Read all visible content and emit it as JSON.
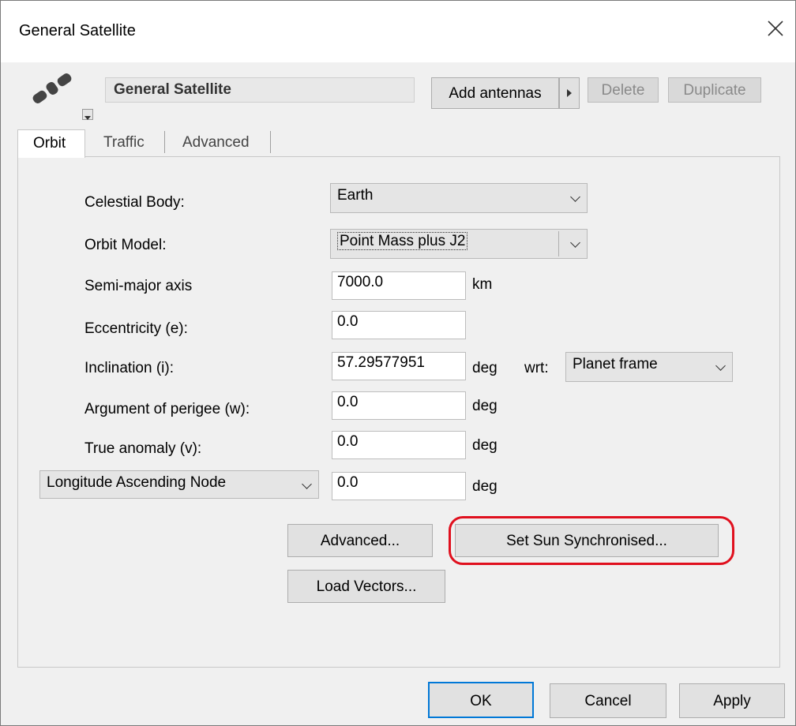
{
  "window": {
    "title": "General Satellite"
  },
  "header": {
    "name_value": "General Satellite",
    "add_antennas_label": "Add antennas",
    "delete_label": "Delete",
    "duplicate_label": "Duplicate"
  },
  "tabs": [
    {
      "label": "Orbit",
      "active": true
    },
    {
      "label": "Traffic",
      "active": false
    },
    {
      "label": "Advanced",
      "active": false
    }
  ],
  "orbit": {
    "celestial_body_label": "Celestial Body:",
    "celestial_body_value": "Earth",
    "orbit_model_label": "Orbit Model:",
    "orbit_model_value": "Point Mass plus J2",
    "semi_major_axis_label": "Semi-major axis",
    "semi_major_axis_value": "7000.0",
    "semi_major_axis_unit": "km",
    "eccentricity_label": "Eccentricity (e):",
    "eccentricity_value": "0.0",
    "inclination_label": "Inclination (i):",
    "inclination_value": "57.29577951",
    "inclination_unit": "deg",
    "wrt_label": "wrt:",
    "wrt_value": "Planet frame",
    "arg_perigee_label": "Argument of perigee (w):",
    "arg_perigee_value": "0.0",
    "arg_perigee_unit": "deg",
    "true_anomaly_label": "True anomaly (v):",
    "true_anomaly_value": "0.0",
    "true_anomaly_unit": "deg",
    "node_type_value": "Longitude Ascending Node",
    "node_value": "0.0",
    "node_unit": "deg",
    "advanced_button": "Advanced...",
    "sun_sync_button": "Set Sun Synchronised...",
    "load_vectors_button": "Load Vectors..."
  },
  "footer": {
    "ok_label": "OK",
    "cancel_label": "Cancel",
    "apply_label": "Apply"
  },
  "colors": {
    "highlight": "#e0101e",
    "default_button_border": "#0078d7"
  }
}
